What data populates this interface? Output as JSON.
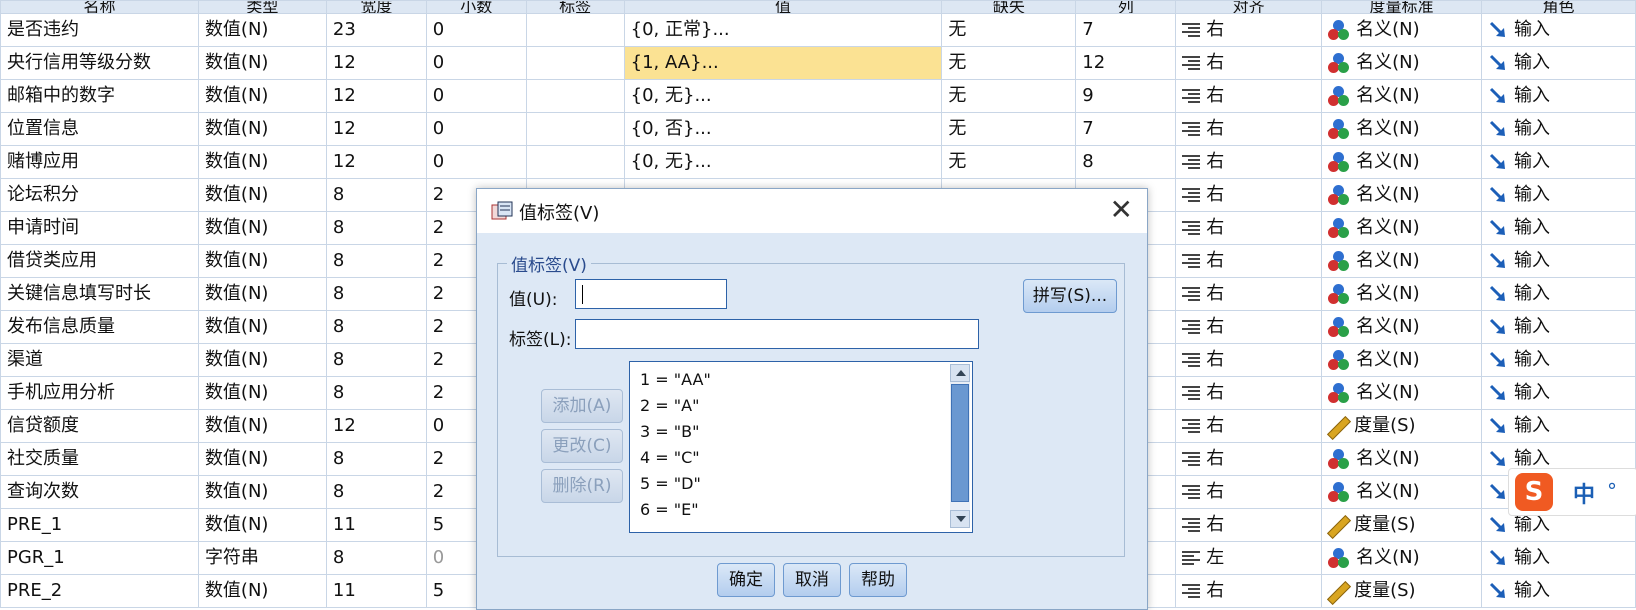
{
  "header": [
    "名称",
    "类型",
    "宽度",
    "小数",
    "标签",
    "值",
    "缺失",
    "列",
    "对齐",
    "度量标准",
    "角色"
  ],
  "rows": [
    {
      "name": "是否违约",
      "type": "数值(N)",
      "width": "23",
      "decimals": "0",
      "label": "",
      "values": "{0, 正常}...",
      "missing": "无",
      "columns": "7",
      "align": "右",
      "measure": "名义(N)",
      "role": "输入"
    },
    {
      "name": "央行信用等级分数",
      "type": "数值(N)",
      "width": "12",
      "decimals": "0",
      "label": "",
      "values": "{1, AA}...",
      "missing": "无",
      "columns": "12",
      "align": "右",
      "measure": "名义(N)",
      "role": "输入",
      "selected": true
    },
    {
      "name": "邮箱中的数字",
      "type": "数值(N)",
      "width": "12",
      "decimals": "0",
      "label": "",
      "values": "{0, 无}...",
      "missing": "无",
      "columns": "9",
      "align": "右",
      "measure": "名义(N)",
      "role": "输入"
    },
    {
      "name": "位置信息",
      "type": "数值(N)",
      "width": "12",
      "decimals": "0",
      "label": "",
      "values": "{0, 否}...",
      "missing": "无",
      "columns": "7",
      "align": "右",
      "measure": "名义(N)",
      "role": "输入"
    },
    {
      "name": "赌博应用",
      "type": "数值(N)",
      "width": "12",
      "decimals": "0",
      "label": "",
      "values": "{0, 无}...",
      "missing": "无",
      "columns": "8",
      "align": "右",
      "measure": "名义(N)",
      "role": "输入"
    },
    {
      "name": "论坛积分",
      "type": "数值(N)",
      "width": "8",
      "decimals": "2",
      "label": "",
      "values": "",
      "missing": "",
      "columns": "",
      "align": "右",
      "measure": "名义(N)",
      "role": "输入"
    },
    {
      "name": "申请时间",
      "type": "数值(N)",
      "width": "8",
      "decimals": "2",
      "label": "",
      "values": "",
      "missing": "",
      "columns": "",
      "align": "右",
      "measure": "名义(N)",
      "role": "输入"
    },
    {
      "name": "借贷类应用",
      "type": "数值(N)",
      "width": "8",
      "decimals": "2",
      "label": "",
      "values": "",
      "missing": "",
      "columns": "",
      "align": "右",
      "measure": "名义(N)",
      "role": "输入"
    },
    {
      "name": "关键信息填写时长",
      "type": "数值(N)",
      "width": "8",
      "decimals": "2",
      "label": "",
      "values": "",
      "missing": "",
      "columns": "",
      "align": "右",
      "measure": "名义(N)",
      "role": "输入"
    },
    {
      "name": "发布信息质量",
      "type": "数值(N)",
      "width": "8",
      "decimals": "2",
      "label": "",
      "values": "",
      "missing": "",
      "columns": "",
      "align": "右",
      "measure": "名义(N)",
      "role": "输入"
    },
    {
      "name": "渠道",
      "type": "数值(N)",
      "width": "8",
      "decimals": "2",
      "label": "",
      "values": "",
      "missing": "",
      "columns": "",
      "align": "右",
      "measure": "名义(N)",
      "role": "输入"
    },
    {
      "name": "手机应用分析",
      "type": "数值(N)",
      "width": "8",
      "decimals": "2",
      "label": "",
      "values": "",
      "missing": "",
      "columns": "",
      "align": "右",
      "measure": "名义(N)",
      "role": "输入"
    },
    {
      "name": "信贷额度",
      "type": "数值(N)",
      "width": "12",
      "decimals": "0",
      "label": "",
      "values": "",
      "missing": "",
      "columns": "",
      "align": "右",
      "measure": "度量(S)",
      "role": "输入"
    },
    {
      "name": "社交质量",
      "type": "数值(N)",
      "width": "8",
      "decimals": "2",
      "label": "",
      "values": "",
      "missing": "",
      "columns": "",
      "align": "右",
      "measure": "名义(N)",
      "role": "输入"
    },
    {
      "name": "查询次数",
      "type": "数值(N)",
      "width": "8",
      "decimals": "2",
      "label": "",
      "values": "",
      "missing": "",
      "columns": "",
      "align": "右",
      "measure": "名义(N)",
      "role": "输入"
    },
    {
      "name": "PRE_1",
      "type": "数值(N)",
      "width": "11",
      "decimals": "5",
      "label": "",
      "values": "",
      "missing": "",
      "columns": "",
      "align": "右",
      "measure": "度量(S)",
      "role": "输入"
    },
    {
      "name": "PGR_1",
      "type": "字符串",
      "width": "8",
      "decimals": "0",
      "label": "",
      "values": "",
      "missing": "",
      "columns": "",
      "align": "左",
      "measure": "名义(N)",
      "role": "输入",
      "decimals_gray": true
    },
    {
      "name": "PRE_2",
      "type": "数值(N)",
      "width": "11",
      "decimals": "5",
      "label": "",
      "values": "",
      "missing": "",
      "columns": "",
      "align": "右",
      "measure": "度量(S)",
      "role": "输入"
    }
  ],
  "dialog": {
    "title": "值标签(V)",
    "group_label": "值标签(V)",
    "value_label": "值(U):",
    "label_label": "标签(L):",
    "value_input": "",
    "label_input": "",
    "spell_button": "拼写(S)...",
    "add_button": "添加(A)",
    "change_button": "更改(C)",
    "remove_button": "删除(R)",
    "list": [
      "1 = \"AA\"",
      "2 = \"A\"",
      "3 = \"B\"",
      "4 = \"C\"",
      "5 = \"D\"",
      "6 = \"E\""
    ],
    "ok_button": "确定",
    "cancel_button": "取消",
    "help_button": "帮助"
  },
  "ime": {
    "logo": "S",
    "mode": "中",
    "punct": "°"
  }
}
